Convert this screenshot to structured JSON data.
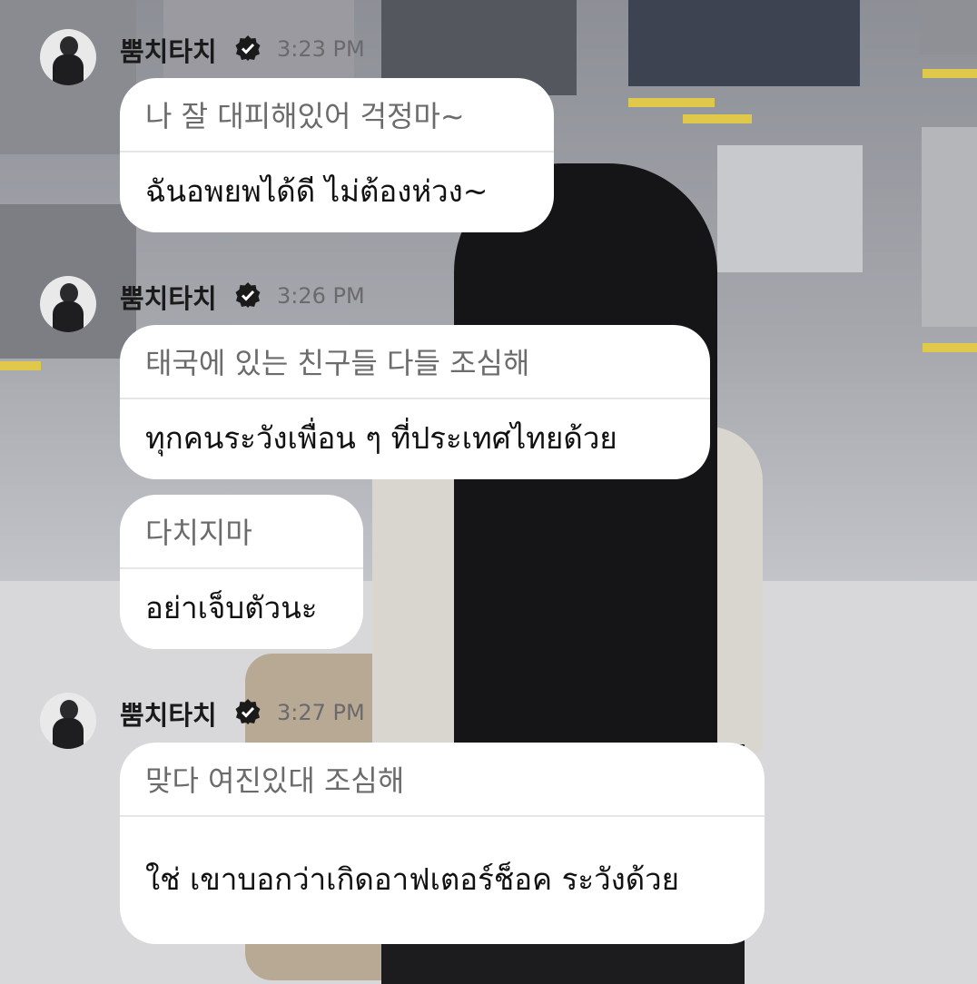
{
  "messages": [
    {
      "sender": "뿜치타치",
      "time": "3:23 PM",
      "bubbles": [
        {
          "original": "나 잘 대피해있어 걱정마~",
          "translation": "ฉันอพยพได้ดี ไม่ต้องห่วง~"
        }
      ]
    },
    {
      "sender": "뿜치타치",
      "time": "3:26 PM",
      "bubbles": [
        {
          "original": "태국에 있는 친구들 다들 조심해",
          "translation": "ทุกคนระวังเพื่อน ๆ ที่ประเทศไทยด้วย"
        },
        {
          "original": "다치지마",
          "translation": "อย่าเจ็บตัวนะ"
        }
      ]
    },
    {
      "sender": "뿜치타치",
      "time": "3:27 PM",
      "bubbles": [
        {
          "original": "맞다 여진있대 조심해",
          "translation": "ใช่ เขาบอกว่าเกิดอาฟเตอร์ช็อค ระวังด้วย"
        }
      ]
    }
  ],
  "icons": {
    "verified": "verified-check-icon",
    "avatar": "user-avatar"
  },
  "colors": {
    "bubble": "#ffffff",
    "original_text": "#6b6b6b",
    "translation_text": "#111111",
    "time_text": "#6a6a6d"
  }
}
